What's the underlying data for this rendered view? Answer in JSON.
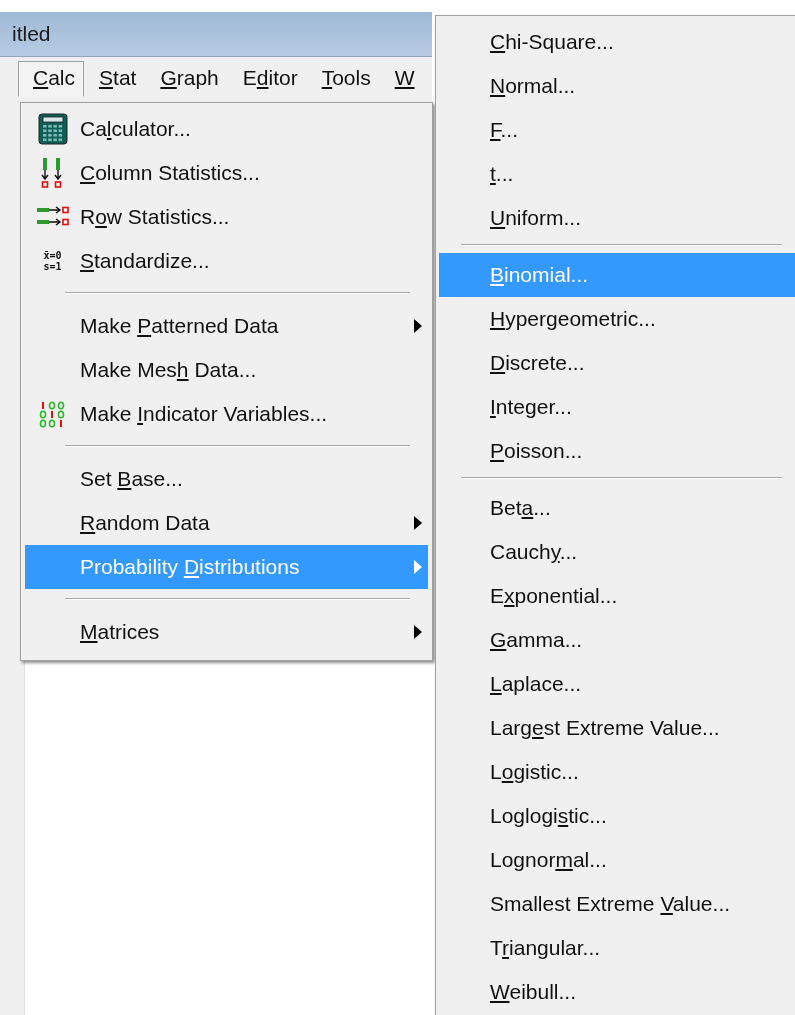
{
  "window": {
    "title": "itled"
  },
  "menubar": [
    {
      "key": "C",
      "post": "alc",
      "selected": true
    },
    {
      "key": "S",
      "post": "tat",
      "selected": false
    },
    {
      "key": "G",
      "post": "raph",
      "selected": false
    },
    {
      "pre": "E",
      "key": "d",
      "post": "itor",
      "selected": false
    },
    {
      "key": "T",
      "post": "ools",
      "selected": false
    },
    {
      "key": "W",
      "selected": false
    }
  ],
  "calc_menu": [
    {
      "kind": "calculator",
      "pre": "Ca",
      "key": "l",
      "post": "culator...",
      "submenu": false,
      "selected": false
    },
    {
      "kind": "column-stats",
      "key": "C",
      "post": "olumn Statistics...",
      "submenu": false,
      "selected": false
    },
    {
      "kind": "row-stats",
      "pre": "R",
      "key": "o",
      "post": "w Statistics...",
      "submenu": false,
      "selected": false
    },
    {
      "kind": "standardize",
      "icon_text": [
        "x̄=0",
        "s=1"
      ],
      "key": "S",
      "post": "tandardize...",
      "submenu": false,
      "selected": false
    },
    {
      "kind": "separator"
    },
    {
      "kind": "plain",
      "pre": "Make ",
      "key": "P",
      "post": "atterned Data",
      "submenu": true,
      "selected": false
    },
    {
      "kind": "plain",
      "pre": "Make Mes",
      "key": "h",
      "post": " Data...",
      "submenu": false,
      "selected": false
    },
    {
      "kind": "indicator",
      "pre": "Make ",
      "key": "I",
      "post": "ndicator Variables...",
      "submenu": false,
      "selected": false
    },
    {
      "kind": "separator"
    },
    {
      "kind": "plain",
      "pre": "Set ",
      "key": "B",
      "post": "ase...",
      "submenu": false,
      "selected": false
    },
    {
      "kind": "plain",
      "key": "R",
      "post": "andom Data",
      "submenu": true,
      "selected": false
    },
    {
      "kind": "plain",
      "pre": "Probability ",
      "key": "D",
      "post": "istributions",
      "submenu": true,
      "selected": true
    },
    {
      "kind": "separator"
    },
    {
      "kind": "plain",
      "key": "M",
      "post": "atrices",
      "submenu": true,
      "selected": false
    }
  ],
  "distributions_menu": [
    {
      "kind": "plain",
      "key": "C",
      "post": "hi-Square...",
      "selected": false
    },
    {
      "kind": "plain",
      "key": "N",
      "post": "ormal...",
      "selected": false
    },
    {
      "kind": "plain",
      "key": "F",
      "post": "...",
      "selected": false
    },
    {
      "kind": "plain",
      "key": "t",
      "post": "...",
      "selected": false
    },
    {
      "kind": "plain",
      "key": "U",
      "post": "niform...",
      "selected": false
    },
    {
      "kind": "separator"
    },
    {
      "kind": "plain",
      "key": "B",
      "post": "inomial...",
      "selected": true
    },
    {
      "kind": "plain",
      "key": "H",
      "post": "ypergeometric...",
      "selected": false
    },
    {
      "kind": "plain",
      "key": "D",
      "post": "iscrete...",
      "selected": false
    },
    {
      "kind": "plain",
      "key": "I",
      "post": "nteger...",
      "selected": false
    },
    {
      "kind": "plain",
      "key": "P",
      "post": "oisson...",
      "selected": false
    },
    {
      "kind": "separator"
    },
    {
      "kind": "plain",
      "pre": "Bet",
      "key": "a",
      "post": "...",
      "selected": false
    },
    {
      "kind": "plain",
      "pre": "Cauch",
      "key": "y",
      "post": "...",
      "selected": false
    },
    {
      "kind": "plain",
      "pre": "E",
      "key": "x",
      "post": "ponential...",
      "selected": false
    },
    {
      "kind": "plain",
      "key": "G",
      "post": "amma...",
      "selected": false
    },
    {
      "kind": "plain",
      "key": "L",
      "post": "aplace...",
      "selected": false
    },
    {
      "kind": "plain",
      "pre": "Larg",
      "key": "e",
      "post": "st Extreme Value...",
      "selected": false
    },
    {
      "kind": "plain",
      "pre": "L",
      "key": "o",
      "post": "gistic...",
      "selected": false
    },
    {
      "kind": "plain",
      "pre": "Loglogi",
      "key": "s",
      "post": "tic...",
      "selected": false
    },
    {
      "kind": "plain",
      "pre": "Lognor",
      "key": "m",
      "post": "al...",
      "selected": false
    },
    {
      "kind": "plain",
      "pre": "Smallest Extreme ",
      "key": "V",
      "post": "alue...",
      "selected": false
    },
    {
      "kind": "plain",
      "pre": "T",
      "key": "r",
      "post": "iangular...",
      "selected": false
    },
    {
      "kind": "plain",
      "key": "W",
      "post": "eibull...",
      "selected": false
    }
  ]
}
